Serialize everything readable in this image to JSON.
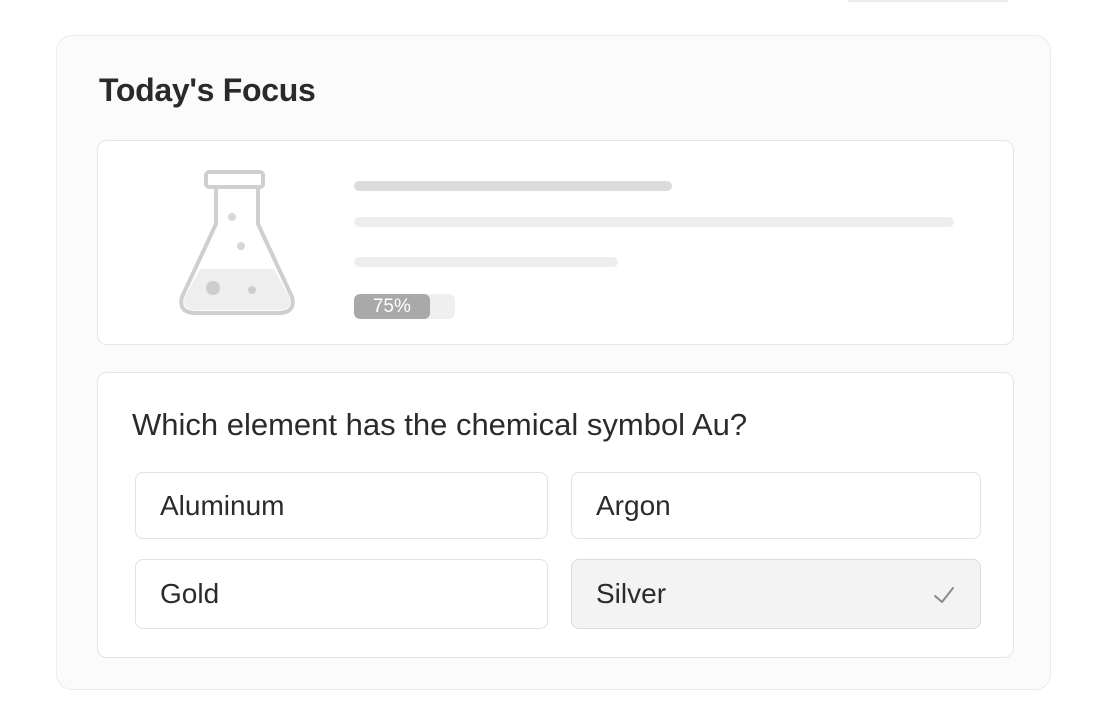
{
  "card": {
    "title": "Today's Focus"
  },
  "lesson": {
    "icon": "flask-icon",
    "progress": {
      "percent": 75,
      "label": "75%"
    }
  },
  "quiz": {
    "question": "Which element has the chemical symbol Au?",
    "options": [
      {
        "label": "Aluminum",
        "selected": false
      },
      {
        "label": "Argon",
        "selected": false
      },
      {
        "label": "Gold",
        "selected": false
      },
      {
        "label": "Silver",
        "selected": true
      }
    ],
    "selected_icon": "check-icon"
  },
  "colors": {
    "progress_fill": "#a9a9a9",
    "progress_track": "#efefef",
    "selected_option_bg": "#f3f3f3"
  }
}
